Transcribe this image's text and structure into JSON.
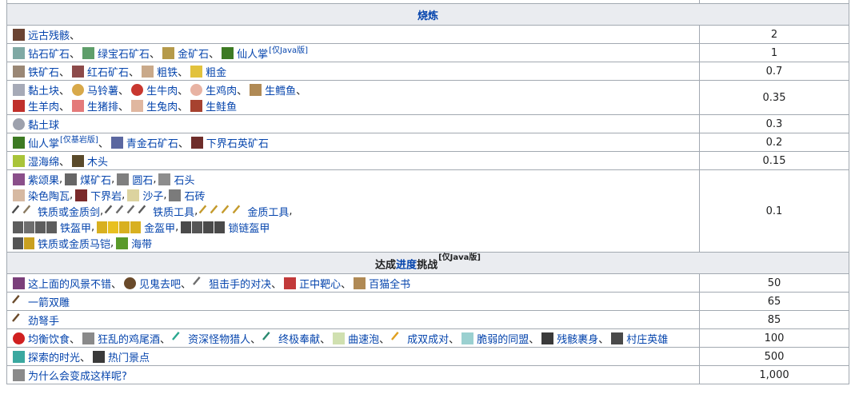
{
  "sections": [
    {
      "title": "烧炼",
      "rows": [
        {
          "value": "2",
          "lines": [
            [
              {
                "icon": "ancient-debris-icon",
                "color": "#6b4433",
                "label": "远古残骸"
              }
            ]
          ]
        },
        {
          "value": "1",
          "lines": [
            [
              {
                "icon": "diamond-ore-icon",
                "color": "#7fa9a4",
                "label": "钻石矿石"
              },
              {
                "icon": "emerald-ore-icon",
                "color": "#5e9e6a",
                "label": "绿宝石矿石"
              },
              {
                "icon": "gold-ore-icon",
                "color": "#b59a4a",
                "label": "金矿石"
              },
              {
                "icon": "cactus-icon",
                "color": "#3d7a23",
                "label": "仙人掌",
                "sup": "[仅Java版]",
                "last": true
              }
            ]
          ]
        },
        {
          "value": "0.7",
          "lines": [
            [
              {
                "icon": "iron-ore-icon",
                "color": "#9a8775",
                "label": "铁矿石"
              },
              {
                "icon": "redstone-ore-icon",
                "color": "#8c4a4a",
                "label": "红石矿石"
              },
              {
                "icon": "raw-iron-icon",
                "color": "#c9a98a",
                "label": "粗铁"
              },
              {
                "icon": "raw-gold-icon",
                "color": "#e2c23c",
                "label": "粗金",
                "last": true
              }
            ]
          ]
        },
        {
          "value": "0.35",
          "lines": [
            [
              {
                "icon": "clay-block-icon",
                "color": "#a6aab7",
                "label": "黏土块"
              },
              {
                "icon": "potato-icon",
                "color": "#d8a94a",
                "label": "马铃薯"
              },
              {
                "icon": "raw-beef-icon",
                "color": "#c8372f",
                "label": "生牛肉"
              },
              {
                "icon": "raw-chicken-icon",
                "color": "#e8b3a3",
                "label": "生鸡肉"
              },
              {
                "icon": "raw-cod-icon",
                "color": "#b08a55",
                "label": "生鳕鱼",
                "trail": "、"
              }
            ],
            [
              {
                "icon": "raw-mutton-icon",
                "color": "#c0302b",
                "label": "生羊肉"
              },
              {
                "icon": "raw-porkchop-icon",
                "color": "#e47a7a",
                "label": "生猪排"
              },
              {
                "icon": "raw-rabbit-icon",
                "color": "#e0b7a0",
                "label": "生兔肉"
              },
              {
                "icon": "raw-salmon-icon",
                "color": "#a7422f",
                "label": "生鲑鱼",
                "last": true
              }
            ]
          ]
        },
        {
          "value": "0.3",
          "lines": [
            [
              {
                "icon": "clay-ball-icon",
                "color": "#9da1ad",
                "label": "黏土球",
                "last": true
              }
            ]
          ]
        },
        {
          "value": "0.2",
          "lines": [
            [
              {
                "icon": "cactus-icon",
                "color": "#3d7a23",
                "label": "仙人掌",
                "sup": "[仅基岩版]"
              },
              {
                "icon": "lapis-ore-icon",
                "color": "#5b67a0",
                "label": "青金石矿石"
              },
              {
                "icon": "nether-quartz-ore-icon",
                "color": "#6e2d2a",
                "label": "下界石英矿石",
                "last": true
              }
            ]
          ]
        },
        {
          "value": "0.15",
          "lines": [
            [
              {
                "icon": "wet-sponge-icon",
                "color": "#a9c43a",
                "label": "湿海绵"
              },
              {
                "icon": "wood-log-icon",
                "color": "#5a4a2a",
                "label": "木头",
                "last": true
              }
            ]
          ]
        },
        {
          "value": "0.1",
          "lines": [
            [
              {
                "icon": "chorus-fruit-icon",
                "color": "#8a4f8a",
                "label": "紫颂果",
                "sepc": ","
              },
              {
                "icon": "coal-ore-icon",
                "color": "#666666",
                "label": "煤矿石",
                "sepc": ","
              },
              {
                "icon": "cobblestone-icon",
                "color": "#7f7f7f",
                "label": "圆石",
                "sepc": ","
              },
              {
                "icon": "stone-icon",
                "color": "#8d8d8d",
                "label": "石头",
                "last": true
              }
            ],
            [
              {
                "icon": "terracotta-icon",
                "color": "#d6b9a2",
                "label": "染色陶瓦",
                "sepc": ","
              },
              {
                "icon": "netherrack-icon",
                "color": "#7a2a2a",
                "label": "下界岩",
                "sepc": ","
              },
              {
                "icon": "sand-icon",
                "color": "#dcd39f",
                "label": "沙子",
                "sepc": ","
              },
              {
                "icon": "stone-bricks-icon",
                "color": "#7b7b7b",
                "label": "石砖",
                "last": true
              }
            ],
            [
              {
                "icons": [
                  "iron-sword-icon",
                  "iron-pickaxe-icon"
                ],
                "colors": [
                  "#4a4a4a",
                  "#8a7a60"
                ],
                "label": "铁质或金质剑",
                "sepc": ","
              },
              {
                "icons": [
                  "iron-pickaxe-icon",
                  "iron-shovel-icon",
                  "iron-hoe-icon",
                  "iron-axe-icon"
                ],
                "colors": [
                  "#5a5a5a",
                  "#6a6a6a",
                  "#6a6a6a",
                  "#5a5a5a"
                ],
                "label": "铁质工具",
                "sepc": ","
              },
              {
                "icons": [
                  "gold-pickaxe-icon",
                  "gold-shovel-icon",
                  "gold-hoe-icon",
                  "gold-axe-icon"
                ],
                "colors": [
                  "#c49a2c",
                  "#c49a2c",
                  "#c49a2c",
                  "#c49a2c"
                ],
                "label": "金质工具",
                "sepc": ","
              }
            ],
            [
              {
                "icons": [
                  "iron-helmet-icon",
                  "iron-chestplate-icon",
                  "iron-leggings-icon",
                  "iron-boots-icon"
                ],
                "colors": [
                  "#5d5d5d",
                  "#6e6e6e",
                  "#5d5d5d",
                  "#5d5d5d"
                ],
                "label": "铁盔甲",
                "sepc": ","
              },
              {
                "icons": [
                  "gold-helmet-icon",
                  "gold-chestplate-icon",
                  "gold-leggings-icon",
                  "gold-boots-icon"
                ],
                "colors": [
                  "#d8b020",
                  "#e8c020",
                  "#d8b020",
                  "#d8b020"
                ],
                "label": "金盔甲",
                "sepc": ","
              },
              {
                "icons": [
                  "chain-helmet-icon",
                  "chain-chestplate-icon",
                  "chain-leggings-icon",
                  "chain-boots-icon"
                ],
                "colors": [
                  "#4a4a4a",
                  "#555555",
                  "#4a4a4a",
                  "#4a4a4a"
                ],
                "label": "锁链盔甲",
                "last": true
              }
            ],
            [
              {
                "icons": [
                  "iron-horse-armor-icon",
                  "gold-horse-armor-icon"
                ],
                "colors": [
                  "#555555",
                  "#c9a020"
                ],
                "label": "铁质或金质马铠",
                "sepc": ","
              },
              {
                "icon": "kelp-icon",
                "color": "#5a9a2a",
                "label": "海带",
                "last": true
              }
            ]
          ]
        }
      ]
    },
    {
      "title_prefix": "达成",
      "title_link": "进度",
      "title_suffix": "挑战",
      "title_sup": "[仅Java版]",
      "rows": [
        {
          "value": "50",
          "lines": [
            [
              {
                "icon": "chorus-fruit-icon",
                "color": "#7a3f7a",
                "label": "这上面的风景不错"
              },
              {
                "icon": "ender-eye-icon",
                "color": "#6a4a2a",
                "label": "见鬼去吧"
              },
              {
                "icon": "arrow-icon",
                "color": "#6e6e6e",
                "label": "狙击手的对决"
              },
              {
                "icon": "target-icon",
                "color": "#c23a3a",
                "label": "正中靶心"
              },
              {
                "icon": "cod-icon",
                "color": "#b08a55",
                "label": "百猫全书",
                "last": true
              }
            ]
          ]
        },
        {
          "value": "65",
          "lines": [
            [
              {
                "icon": "crossbow-icon",
                "color": "#6a4a2a",
                "label": "一箭双雕",
                "last": true
              }
            ]
          ]
        },
        {
          "value": "85",
          "lines": [
            [
              {
                "icon": "crossbow-icon",
                "color": "#6a4a2a",
                "label": "劲弩手",
                "last": true
              }
            ]
          ]
        },
        {
          "value": "100",
          "lines": [
            [
              {
                "icon": "apple-icon",
                "color": "#d02020",
                "label": "均衡饮食"
              },
              {
                "icon": "bucket-icon",
                "color": "#8a8a8a",
                "label": "狂乱的鸡尾酒"
              },
              {
                "icon": "diamond-sword-icon",
                "color": "#2aa890",
                "label": "资深怪物猎人"
              },
              {
                "icon": "netherite-pickaxe-icon",
                "color": "#2a8a70",
                "label": "终极奉献"
              },
              {
                "icon": "elytra-icon",
                "color": "#d0e0b0",
                "label": "曲速泡"
              },
              {
                "icon": "blaze-rod-icon",
                "color": "#e0a020",
                "label": "成双成对"
              },
              {
                "icon": "ghast-tear-icon",
                "color": "#9ad0d0",
                "label": "脆弱的同盟"
              },
              {
                "icon": "netherite-chestplate-icon",
                "color": "#3a3a3a",
                "label": "残骸裹身"
              },
              {
                "icon": "banner-icon",
                "color": "#4a4a4a",
                "label": "村庄英雄",
                "last": true
              }
            ]
          ]
        },
        {
          "value": "500",
          "lines": [
            [
              {
                "icon": "diamond-boots-icon",
                "color": "#3aa8a0",
                "label": "探索的时光"
              },
              {
                "icon": "netherite-boots-icon",
                "color": "#3a3a3a",
                "label": "热门景点",
                "last": true
              }
            ]
          ]
        },
        {
          "value": "1,000",
          "lines": [
            [
              {
                "icon": "bucket-icon",
                "color": "#8a8a8a",
                "label": "为什么会变成这样呢?",
                "last": true
              }
            ]
          ]
        }
      ]
    }
  ]
}
